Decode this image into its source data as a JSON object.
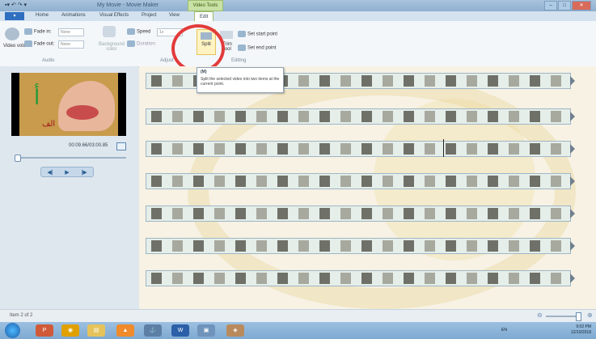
{
  "window": {
    "title": "My Movie - Movie Maker",
    "contextual_tab": "Video Tools",
    "qat": "▪▾ ↶ ↷ ▾",
    "buttons": [
      "–",
      "□",
      "✕"
    ]
  },
  "tabs": [
    "Home",
    "Animations",
    "Visual Effects",
    "Project",
    "View",
    "Edit"
  ],
  "file_tab": "▾",
  "ribbon": {
    "audio": {
      "video_volume_label": "Video volume",
      "fade_in_label": "Fade in:",
      "fade_in_value": "None",
      "fade_out_label": "Fade out:",
      "fade_out_value": "None",
      "group": "Audio"
    },
    "adjust": {
      "background_label": "Background color",
      "speed_label": "Speed",
      "speed_value": "1x",
      "duration_label": "Duration:",
      "group": "Adjust"
    },
    "editing": {
      "split_label": "Split",
      "trim_label": "Trim tool",
      "set_start": "Set start point",
      "set_end": "Set end point",
      "group": "Editing"
    }
  },
  "tooltip": {
    "title": "(M)",
    "text": "Split the selected video into two items at the current point."
  },
  "preview": {
    "letter": "أ",
    "word": "الف",
    "timecode": "00:09.66/03:00.85"
  },
  "player": {
    "prev": "◀|",
    "play": "▶",
    "next": "|▶"
  },
  "status": {
    "item": "Item 2 of 2"
  },
  "taskbar": {
    "apps": [
      "P",
      "◉",
      "▤",
      "▲",
      "⚓",
      "W",
      "▣",
      "◈"
    ],
    "lang": "EN",
    "time": "9:02 PM",
    "date": "12/10/2018"
  }
}
